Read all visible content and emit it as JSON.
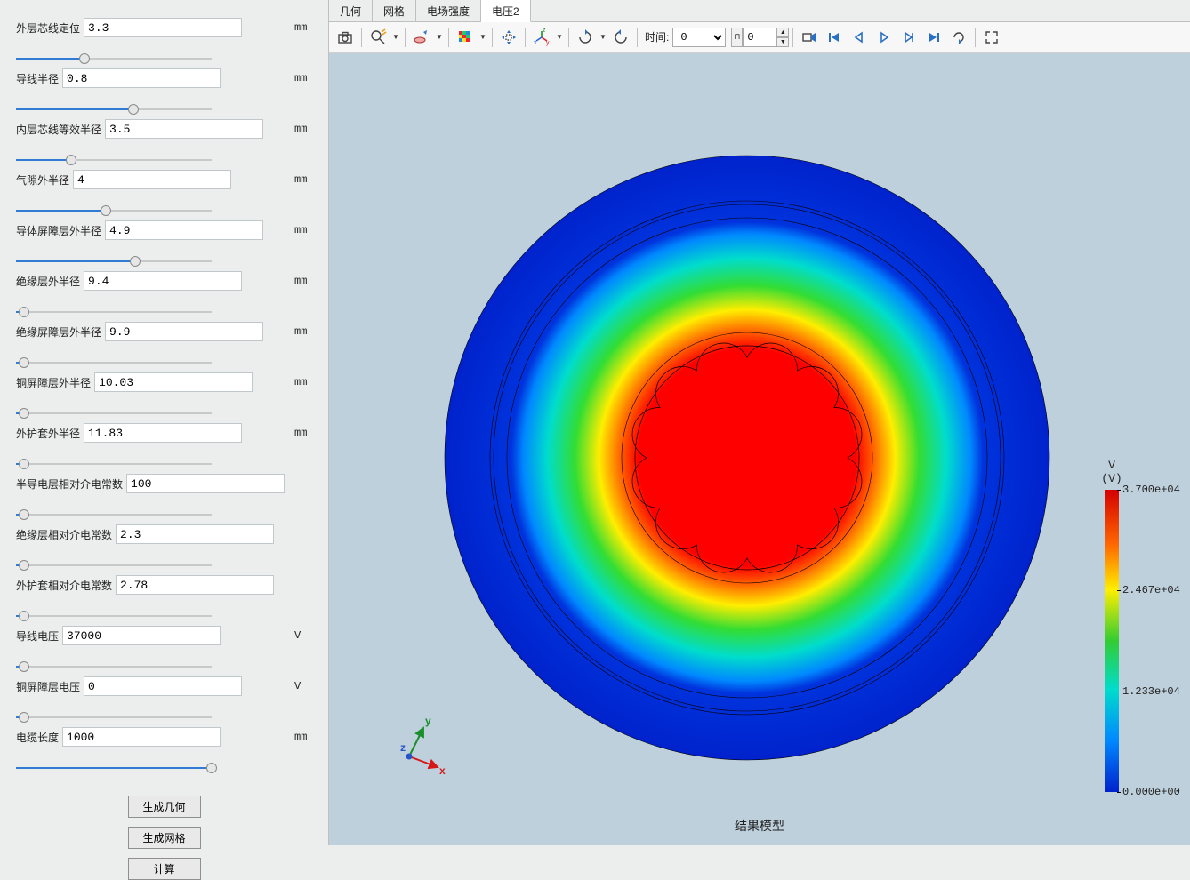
{
  "sidebar": {
    "params": [
      {
        "label": "外层芯线定位",
        "value": "3.3",
        "unit": "mm",
        "pct": 35
      },
      {
        "label": "导线半径",
        "value": "0.8",
        "unit": "mm",
        "pct": 60
      },
      {
        "label": "内层芯线等效半径",
        "value": "3.5",
        "unit": "mm",
        "pct": 28
      },
      {
        "label": "气隙外半径",
        "value": "4",
        "unit": "mm",
        "pct": 46
      },
      {
        "label": "导体屏障层外半径",
        "value": "4.9",
        "unit": "mm",
        "pct": 61
      },
      {
        "label": "绝缘层外半径",
        "value": "9.4",
        "unit": "mm",
        "pct": 4
      },
      {
        "label": "绝缘屏障层外半径",
        "value": "9.9",
        "unit": "mm",
        "pct": 4
      },
      {
        "label": "铜屏障层外半径",
        "value": "10.03",
        "unit": "mm",
        "pct": 4
      },
      {
        "label": "外护套外半径",
        "value": "11.83",
        "unit": "mm",
        "pct": 4
      },
      {
        "label": "半导电层相对介电常数",
        "value": "100",
        "unit": "",
        "pct": 4
      },
      {
        "label": "绝缘层相对介电常数",
        "value": "2.3",
        "unit": "",
        "pct": 4
      },
      {
        "label": "外护套相对介电常数",
        "value": "2.78",
        "unit": "",
        "pct": 4
      },
      {
        "label": "导线电压",
        "value": "37000",
        "unit": "V",
        "pct": 4
      },
      {
        "label": "铜屏障层电压",
        "value": "0",
        "unit": "V",
        "pct": 4
      },
      {
        "label": "电缆长度",
        "value": "1000",
        "unit": "mm",
        "pct": 100
      }
    ],
    "buttons": {
      "gen_geom": "生成几何",
      "gen_mesh": "生成网格",
      "compute": "计算"
    }
  },
  "main": {
    "tabs": [
      "几何",
      "网格",
      "电场强度",
      "电压2"
    ],
    "active_tab": 3,
    "toolbar": {
      "time_label": "时间:",
      "time_dropdown_value": "0",
      "time_input_value": "0"
    },
    "axis_triad": {
      "x": "x",
      "y": "y",
      "z": "z"
    },
    "result_label": "结果模型",
    "legend": {
      "title_line1": "V",
      "title_line2": "(V)",
      "ticks": [
        {
          "pos": 0,
          "text": "3.700e+04"
        },
        {
          "pos": 33.33,
          "text": "2.467e+04"
        },
        {
          "pos": 66.67,
          "text": "1.233e+04"
        },
        {
          "pos": 100,
          "text": "0.000e+00"
        }
      ]
    }
  },
  "chart_data": {
    "type": "heatmap",
    "title": "结果模型",
    "quantity": "V",
    "unit": "V",
    "colormap": "rainbow",
    "value_range": [
      0,
      37000
    ],
    "geometry": "radial-field",
    "description": "Electric potential (V) over cable cross-section; red center = 3.7e4 V, blue outer = 0 V",
    "ticks": [
      0,
      12330,
      24670,
      37000
    ]
  }
}
